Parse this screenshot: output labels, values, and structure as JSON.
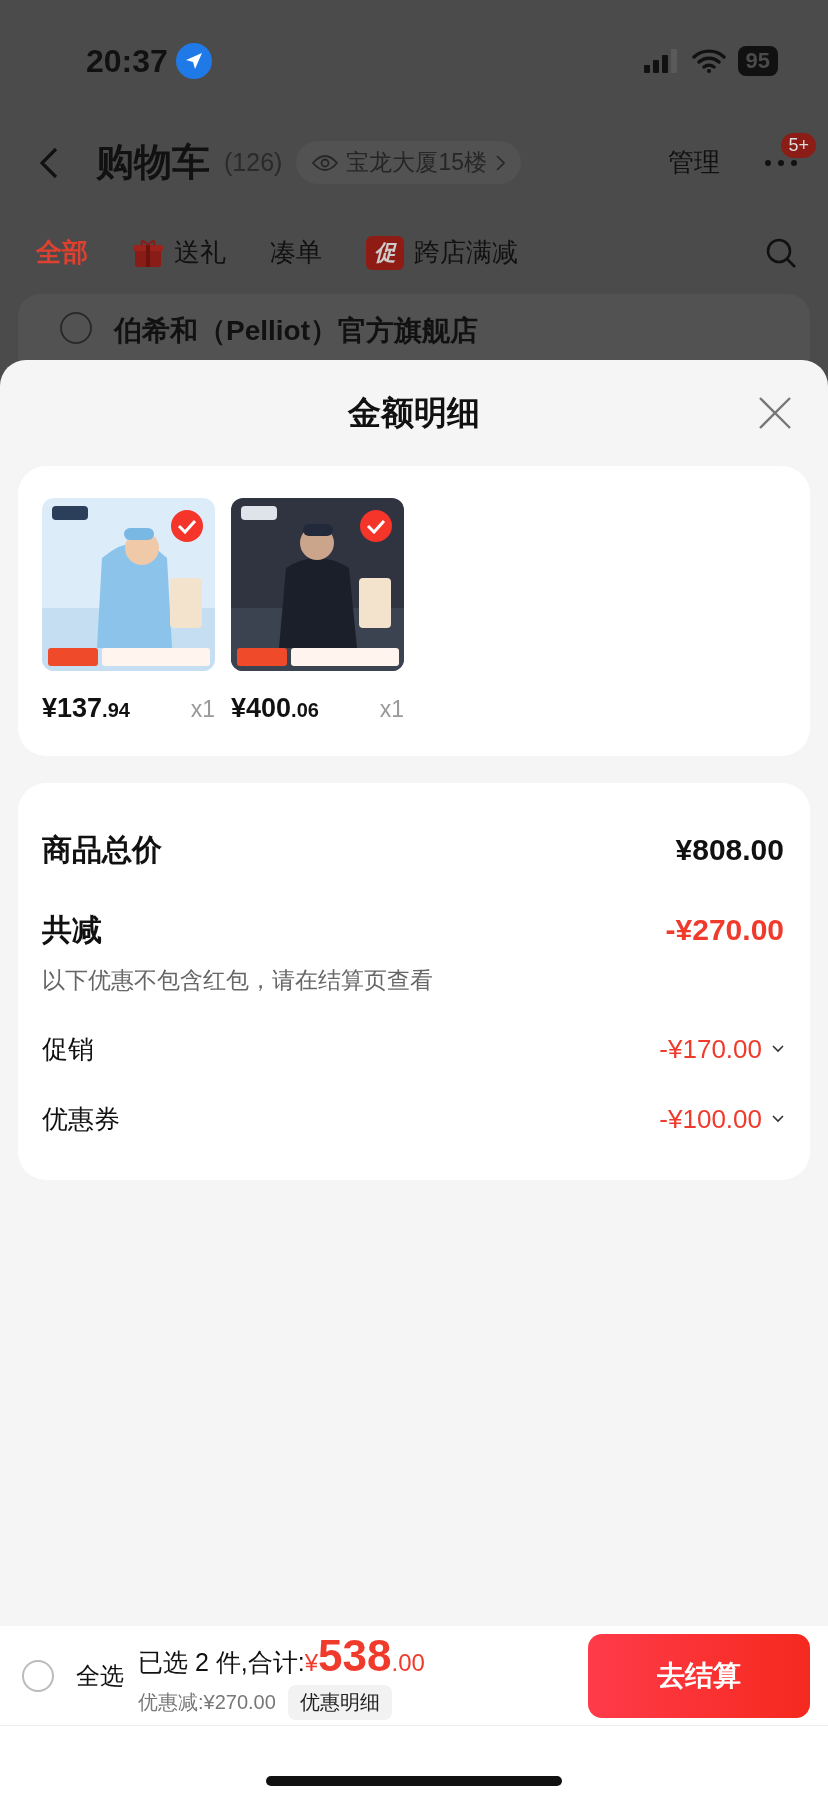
{
  "status_bar": {
    "time": "20:37",
    "battery": "95"
  },
  "header": {
    "title": "购物车",
    "count": "(126)",
    "location": "宝龙大厦15楼",
    "manage": "管理",
    "more_badge": "5+"
  },
  "tabs": [
    {
      "label": "全部",
      "selected": true,
      "kind": "plain"
    },
    {
      "label": "送礼",
      "selected": false,
      "kind": "gift"
    },
    {
      "label": "凑单",
      "selected": false,
      "kind": "plain"
    },
    {
      "label": "跨店满减",
      "selected": false,
      "kind": "promo",
      "badge": "促"
    }
  ],
  "store": {
    "name": "伯希和（Pelliot）官方旗舰店",
    "checked": false
  },
  "sheet": {
    "title": "金额明细",
    "items": [
      {
        "price": "¥137",
        "cents": ".94",
        "qty": "x1",
        "selected": true
      },
      {
        "price": "¥400",
        "cents": ".06",
        "qty": "x1",
        "selected": true
      }
    ],
    "summary": [
      {
        "kind": "total",
        "label": "商品总价",
        "value": "¥808.00"
      },
      {
        "kind": "discount",
        "label": "共减",
        "value": "-¥270.00",
        "note": "以下优惠不包含红包，请在结算页查看"
      },
      {
        "kind": "detail",
        "label": "促销",
        "value": "-¥170.00"
      },
      {
        "kind": "detail",
        "label": "优惠券",
        "value": "-¥100.00"
      }
    ]
  },
  "footer": {
    "select_all": {
      "label": "全选",
      "checked": false
    },
    "selected_text": "已选 2 件,合计:",
    "currency": "¥",
    "amount": "538",
    "cents": ".00",
    "discount": "优惠减:¥270.00",
    "detail_button": "优惠明细",
    "checkout": "去结算"
  }
}
